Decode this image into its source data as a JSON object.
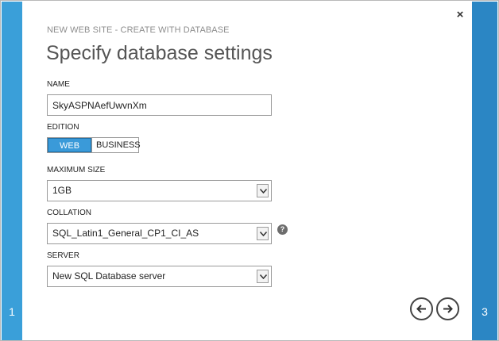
{
  "wizard": {
    "title": "NEW WEB SITE - CREATE WITH DATABASE",
    "page_title": "Specify database settings",
    "steps": {
      "left": "1",
      "right": "3"
    },
    "close_glyph": "×",
    "close_icon": "close-icon"
  },
  "form": {
    "name": {
      "label": "NAME",
      "value": "SkyASPNAefUwvnXm"
    },
    "edition": {
      "label": "EDITION",
      "options": [
        "WEB",
        "BUSINESS"
      ],
      "selected": "WEB"
    },
    "max_size": {
      "label": "MAXIMUM SIZE",
      "value": "1GB"
    },
    "collation": {
      "label": "COLLATION",
      "value": "SQL_Latin1_General_CP1_CI_AS",
      "help_glyph": "?"
    },
    "server": {
      "label": "SERVER",
      "value": "New SQL Database server"
    }
  },
  "nav": {
    "prev_icon": "arrow-left-icon",
    "next_icon": "arrow-right-icon"
  },
  "colors": {
    "step_left": "#3a9fd9",
    "step_right": "#2b86c4",
    "toggle_selected": "#3a9ad9"
  }
}
